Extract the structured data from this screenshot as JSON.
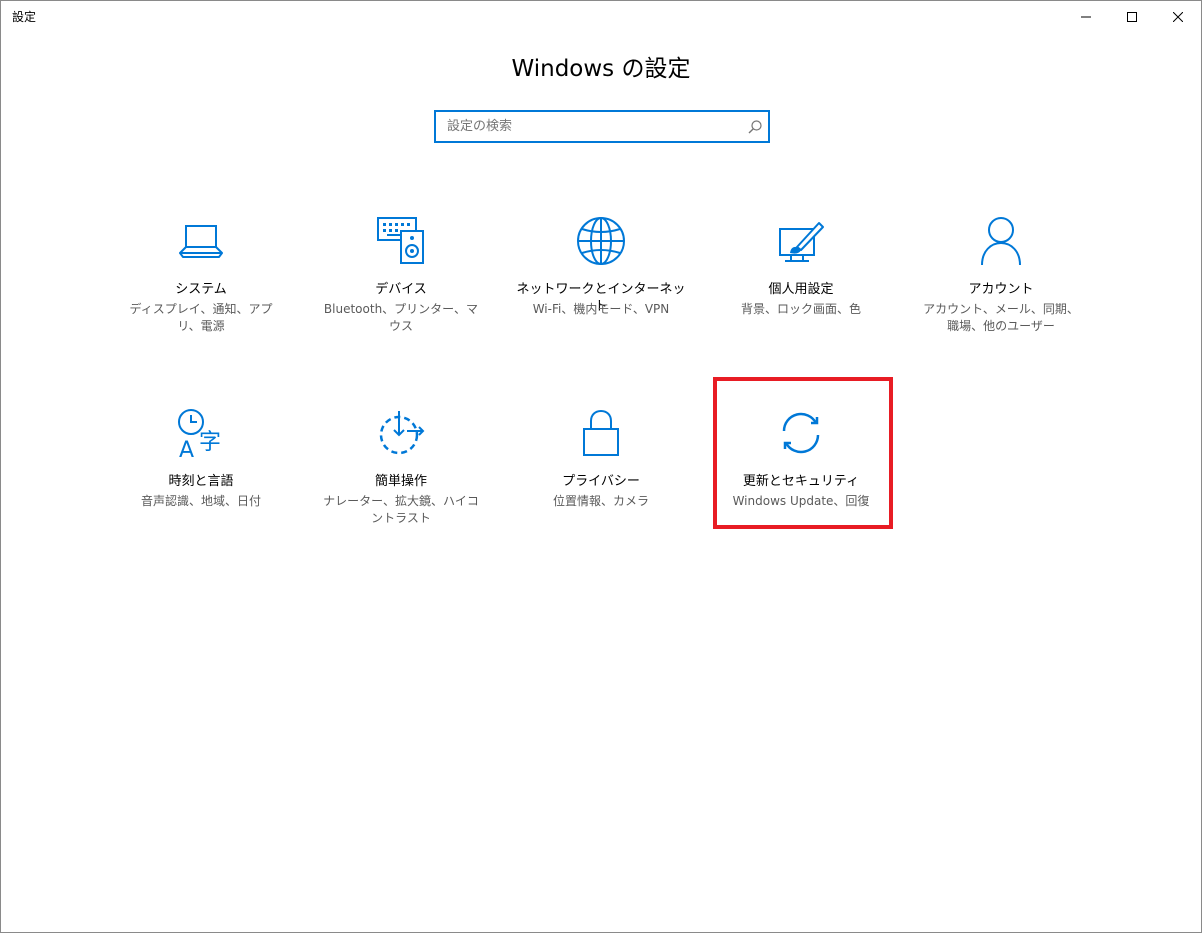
{
  "window": {
    "title": "設定",
    "controls": {
      "minimize": "minimize-icon",
      "maximize": "maximize-icon",
      "close": "close-icon"
    }
  },
  "header": {
    "title": "Windows の設定"
  },
  "search": {
    "placeholder": "設定の検索",
    "value": ""
  },
  "colors": {
    "accent": "#0078d7",
    "highlight": "#e81c24"
  },
  "categories": [
    {
      "icon": "laptop-icon",
      "label": "システム",
      "description": "ディスプレイ、通知、アプリ、電源"
    },
    {
      "icon": "keyboard-speaker-icon",
      "label": "デバイス",
      "description": "Bluetooth、プリンター、マウス"
    },
    {
      "icon": "globe-icon",
      "label": "ネットワークとインターネット",
      "description": "Wi-Fi、機内モード、VPN"
    },
    {
      "icon": "paint-icon",
      "label": "個人用設定",
      "description": "背景、ロック画面、色"
    },
    {
      "icon": "person-icon",
      "label": "アカウント",
      "description": "アカウント、メール、同期、職場、他のユーザー"
    },
    {
      "icon": "time-language-icon",
      "label": "時刻と言語",
      "description": "音声認識、地域、日付"
    },
    {
      "icon": "ease-of-access-icon",
      "label": "簡単操作",
      "description": "ナレーター、拡大鏡、ハイコントラスト"
    },
    {
      "icon": "lock-icon",
      "label": "プライバシー",
      "description": "位置情報、カメラ"
    },
    {
      "icon": "update-sync-icon",
      "label": "更新とセキュリティ",
      "description": "Windows Update、回復"
    }
  ]
}
